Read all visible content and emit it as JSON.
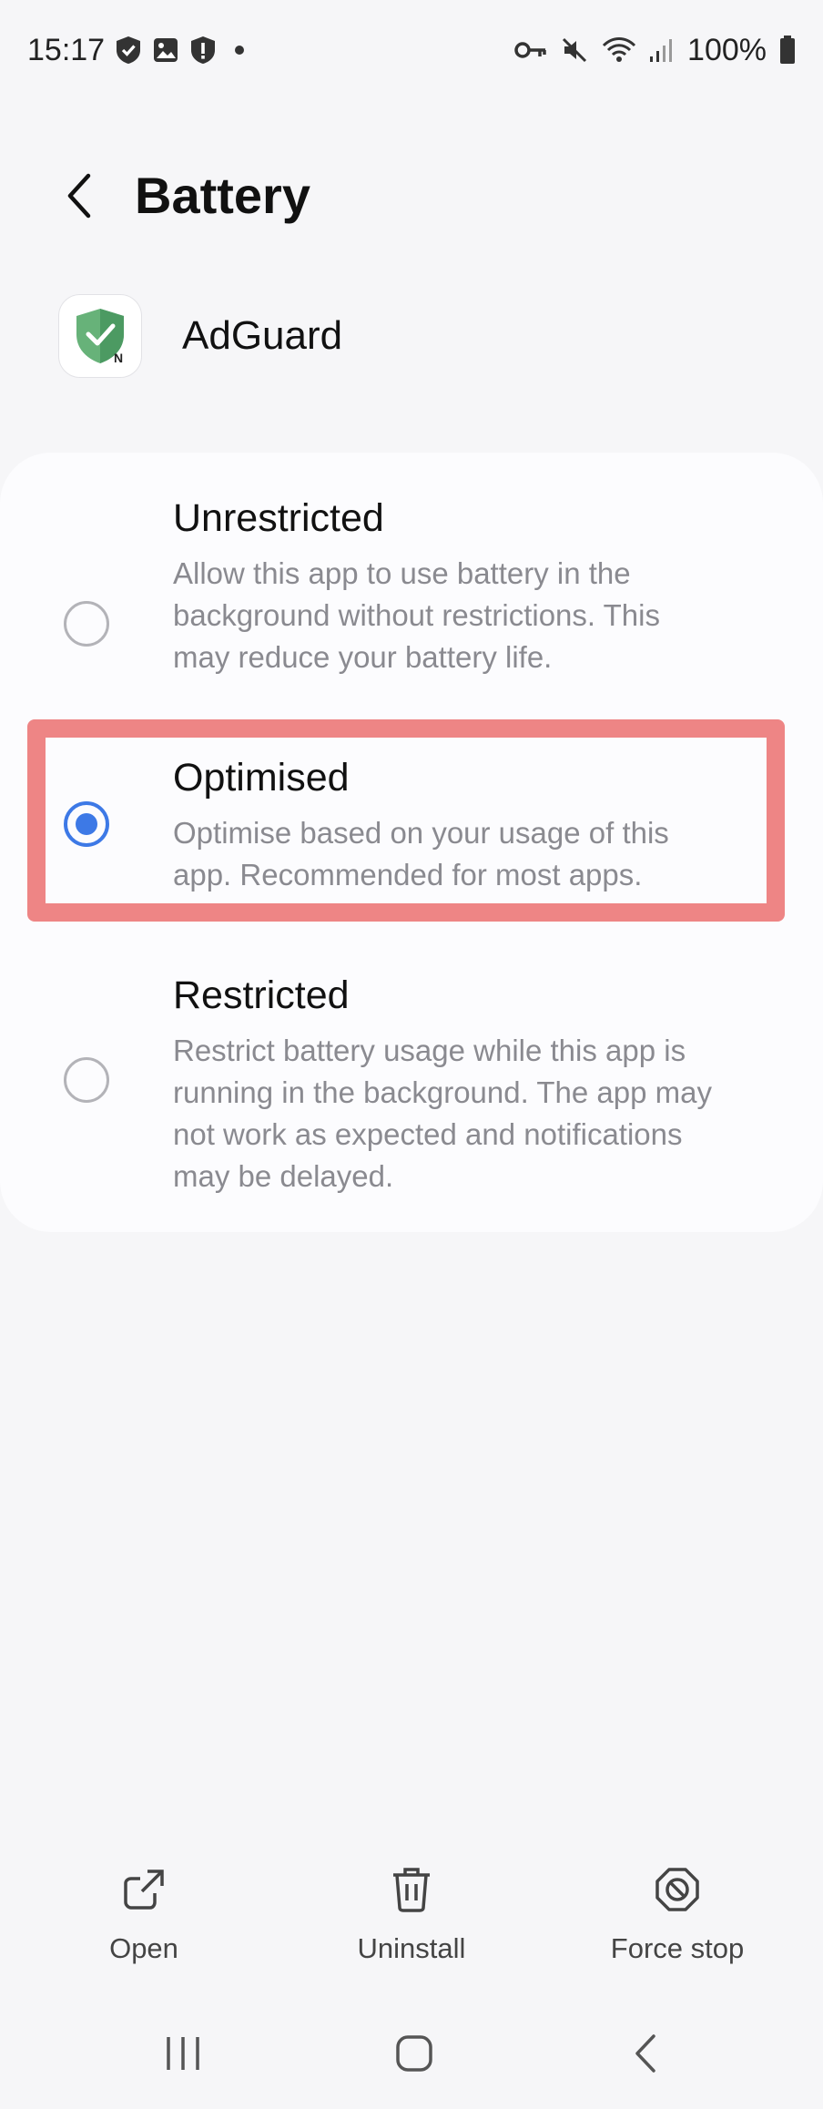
{
  "status_bar": {
    "time": "15:17",
    "battery_text": "100%",
    "left_icons": [
      "shield-check-icon",
      "image-icon",
      "shield-alert-icon",
      "dot-icon"
    ],
    "right_icons": [
      "vpn-key-icon",
      "mute-icon",
      "wifi-icon",
      "signal-icon",
      "battery-icon"
    ]
  },
  "header": {
    "title": "Battery"
  },
  "app": {
    "name": "AdGuard",
    "icon": "adguard-shield-icon"
  },
  "options": [
    {
      "title": "Unrestricted",
      "description": "Allow this app to use battery in the background without restrictions. This may reduce your battery life.",
      "selected": false
    },
    {
      "title": "Optimised",
      "description": "Optimise based on your usage of this app. Recommended for most apps.",
      "selected": true
    },
    {
      "title": "Restricted",
      "description": "Restrict battery usage while this app is running in the background. The app may not work as expected and notifications may be delayed.",
      "selected": false
    }
  ],
  "actions": {
    "open": "Open",
    "uninstall": "Uninstall",
    "force_stop": "Force stop"
  },
  "colors": {
    "accent": "#3d79e6",
    "highlight": "#ee8585",
    "background": "#f6f6f8"
  }
}
